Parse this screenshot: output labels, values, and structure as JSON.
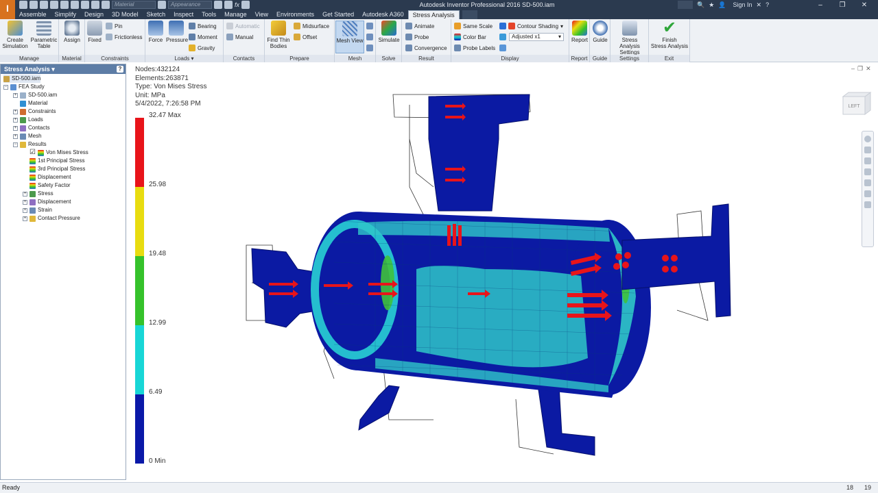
{
  "titlebar": {
    "title": "Autodesk Inventor Professional 2016    SD-500.iam",
    "material_placeholder": "Material",
    "appearance_placeholder": "Appearance",
    "fx": "fx",
    "sign_in": "Sign In",
    "help": "?"
  },
  "tabs": [
    "Assemble",
    "Simplify",
    "Design",
    "3D Model",
    "Sketch",
    "Inspect",
    "Tools",
    "Manage",
    "View",
    "Environments",
    "Get Started",
    "Autodesk A360",
    "Stress Analysis"
  ],
  "ribbon": {
    "manage": {
      "label": "Manage",
      "create": "Create\nSimulation",
      "param": "Parametric\nTable"
    },
    "material": {
      "label": "Material",
      "assign": "Assign"
    },
    "constraints": {
      "label": "Constraints",
      "fixed": "Fixed",
      "pin": "Pin",
      "frictionless": "Frictionless"
    },
    "loads": {
      "label": "Loads",
      "force": "Force",
      "pressure": "Pressure",
      "bearing": "Bearing",
      "moment": "Moment",
      "gravity": "Gravity"
    },
    "contacts": {
      "label": "Contacts",
      "automatic": "Automatic",
      "manual": "Manual"
    },
    "prepare": {
      "label": "Prepare",
      "find": "Find Thin\nBodies",
      "midsurface": "Midsurface",
      "offset": "Offset"
    },
    "mesh": {
      "label": "Mesh",
      "mesh_view": "Mesh View"
    },
    "solve": {
      "label": "Solve",
      "simulate": "Simulate"
    },
    "result": {
      "label": "Result",
      "animate": "Animate",
      "probe": "Probe",
      "convergence": "Convergence"
    },
    "display": {
      "label": "Display",
      "same_scale": "Same Scale",
      "color_bar": "Color Bar",
      "probe_labels": "Probe Labels",
      "contour": "Contour Shading",
      "adjusted": "Adjusted x1"
    },
    "report": {
      "label": "Report",
      "report": "Report"
    },
    "guide": {
      "label": "Guide",
      "guide": "Guide"
    },
    "settings": {
      "label": "Settings",
      "sa_settings": "Stress Analysis\nSettings"
    },
    "exit": {
      "label": "Exit",
      "finish": "Finish\nStress Analysis"
    }
  },
  "browser": {
    "title": "Stress Analysis",
    "nodes": [
      {
        "label": "SD-500.iam",
        "level": 0
      },
      {
        "label": "FEA Study",
        "level": 0
      },
      {
        "label": "SD-500.iam",
        "level": 1
      },
      {
        "label": "Material",
        "level": 1
      },
      {
        "label": "Constraints",
        "level": 1
      },
      {
        "label": "Loads",
        "level": 1
      },
      {
        "label": "Contacts",
        "level": 1
      },
      {
        "label": "Mesh",
        "level": 1
      },
      {
        "label": "Results",
        "level": 1
      },
      {
        "label": "Von Mises Stress",
        "level": 2
      },
      {
        "label": "1st Principal Stress",
        "level": 2
      },
      {
        "label": "3rd Principal Stress",
        "level": 2
      },
      {
        "label": "Displacement",
        "level": 2
      },
      {
        "label": "Safety Factor",
        "level": 2
      },
      {
        "label": "Stress",
        "level": 2
      },
      {
        "label": "Displacement",
        "level": 2
      },
      {
        "label": "Strain",
        "level": 2
      },
      {
        "label": "Contact Pressure",
        "level": 2
      }
    ]
  },
  "viewport": {
    "nodes": "Nodes:432124",
    "elements": "Elements:263871",
    "type": "Type: Von Mises Stress",
    "unit": "Unit: MPa",
    "date": "5/4/2022, 7:26:58 PM",
    "cube_label": "LEFT",
    "legend": {
      "labels": [
        "32.47 Max",
        "25.98",
        "19.48",
        "12.99",
        "6.49",
        "0 Min"
      ],
      "colors": [
        "#e8141a",
        "#e8dc10",
        "#35c22b",
        "#18d6d6",
        "#0a19a8"
      ]
    }
  },
  "status": {
    "text": "Ready",
    "n1": "18",
    "n2": "19"
  }
}
